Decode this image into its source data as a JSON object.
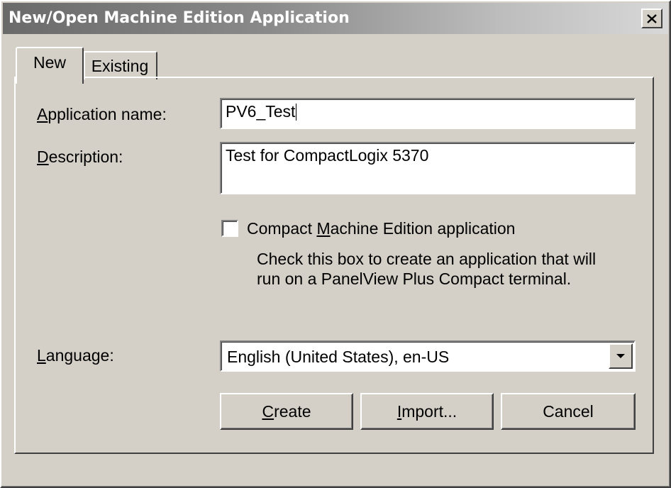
{
  "window": {
    "title": "New/Open Machine Edition Application",
    "close_label": "×"
  },
  "tabs": [
    {
      "label": "New",
      "active": true
    },
    {
      "label": "Existing",
      "active": false
    }
  ],
  "form": {
    "app_name": {
      "label_access": "A",
      "label_rest": "pplication name:",
      "value": "PV6_Test"
    },
    "description": {
      "label_access": "D",
      "label_rest": "escription:",
      "value": "Test for CompactLogix 5370"
    },
    "compact": {
      "label_pre": "Compact ",
      "label_access": "M",
      "label_post": "achine Edition application",
      "checked": false,
      "hint_line1": "Check this box to create an application that will",
      "hint_line2": "run on a PanelView Plus Compact terminal."
    },
    "language": {
      "label_access": "L",
      "label_rest": "anguage:",
      "value": "English (United States), en-US"
    }
  },
  "buttons": {
    "create": {
      "access": "C",
      "rest": "reate"
    },
    "import": {
      "access": "I",
      "rest": "mport..."
    },
    "cancel": {
      "label": "Cancel"
    }
  },
  "colors": {
    "dialog_face": "#d4d0c8",
    "titlebar_start": "#6a6a6a",
    "titlebar_end": "#d8d8d8",
    "field_bg": "#ffffff"
  },
  "icons": {
    "close": "close-icon",
    "dropdown": "chevron-down-icon"
  }
}
